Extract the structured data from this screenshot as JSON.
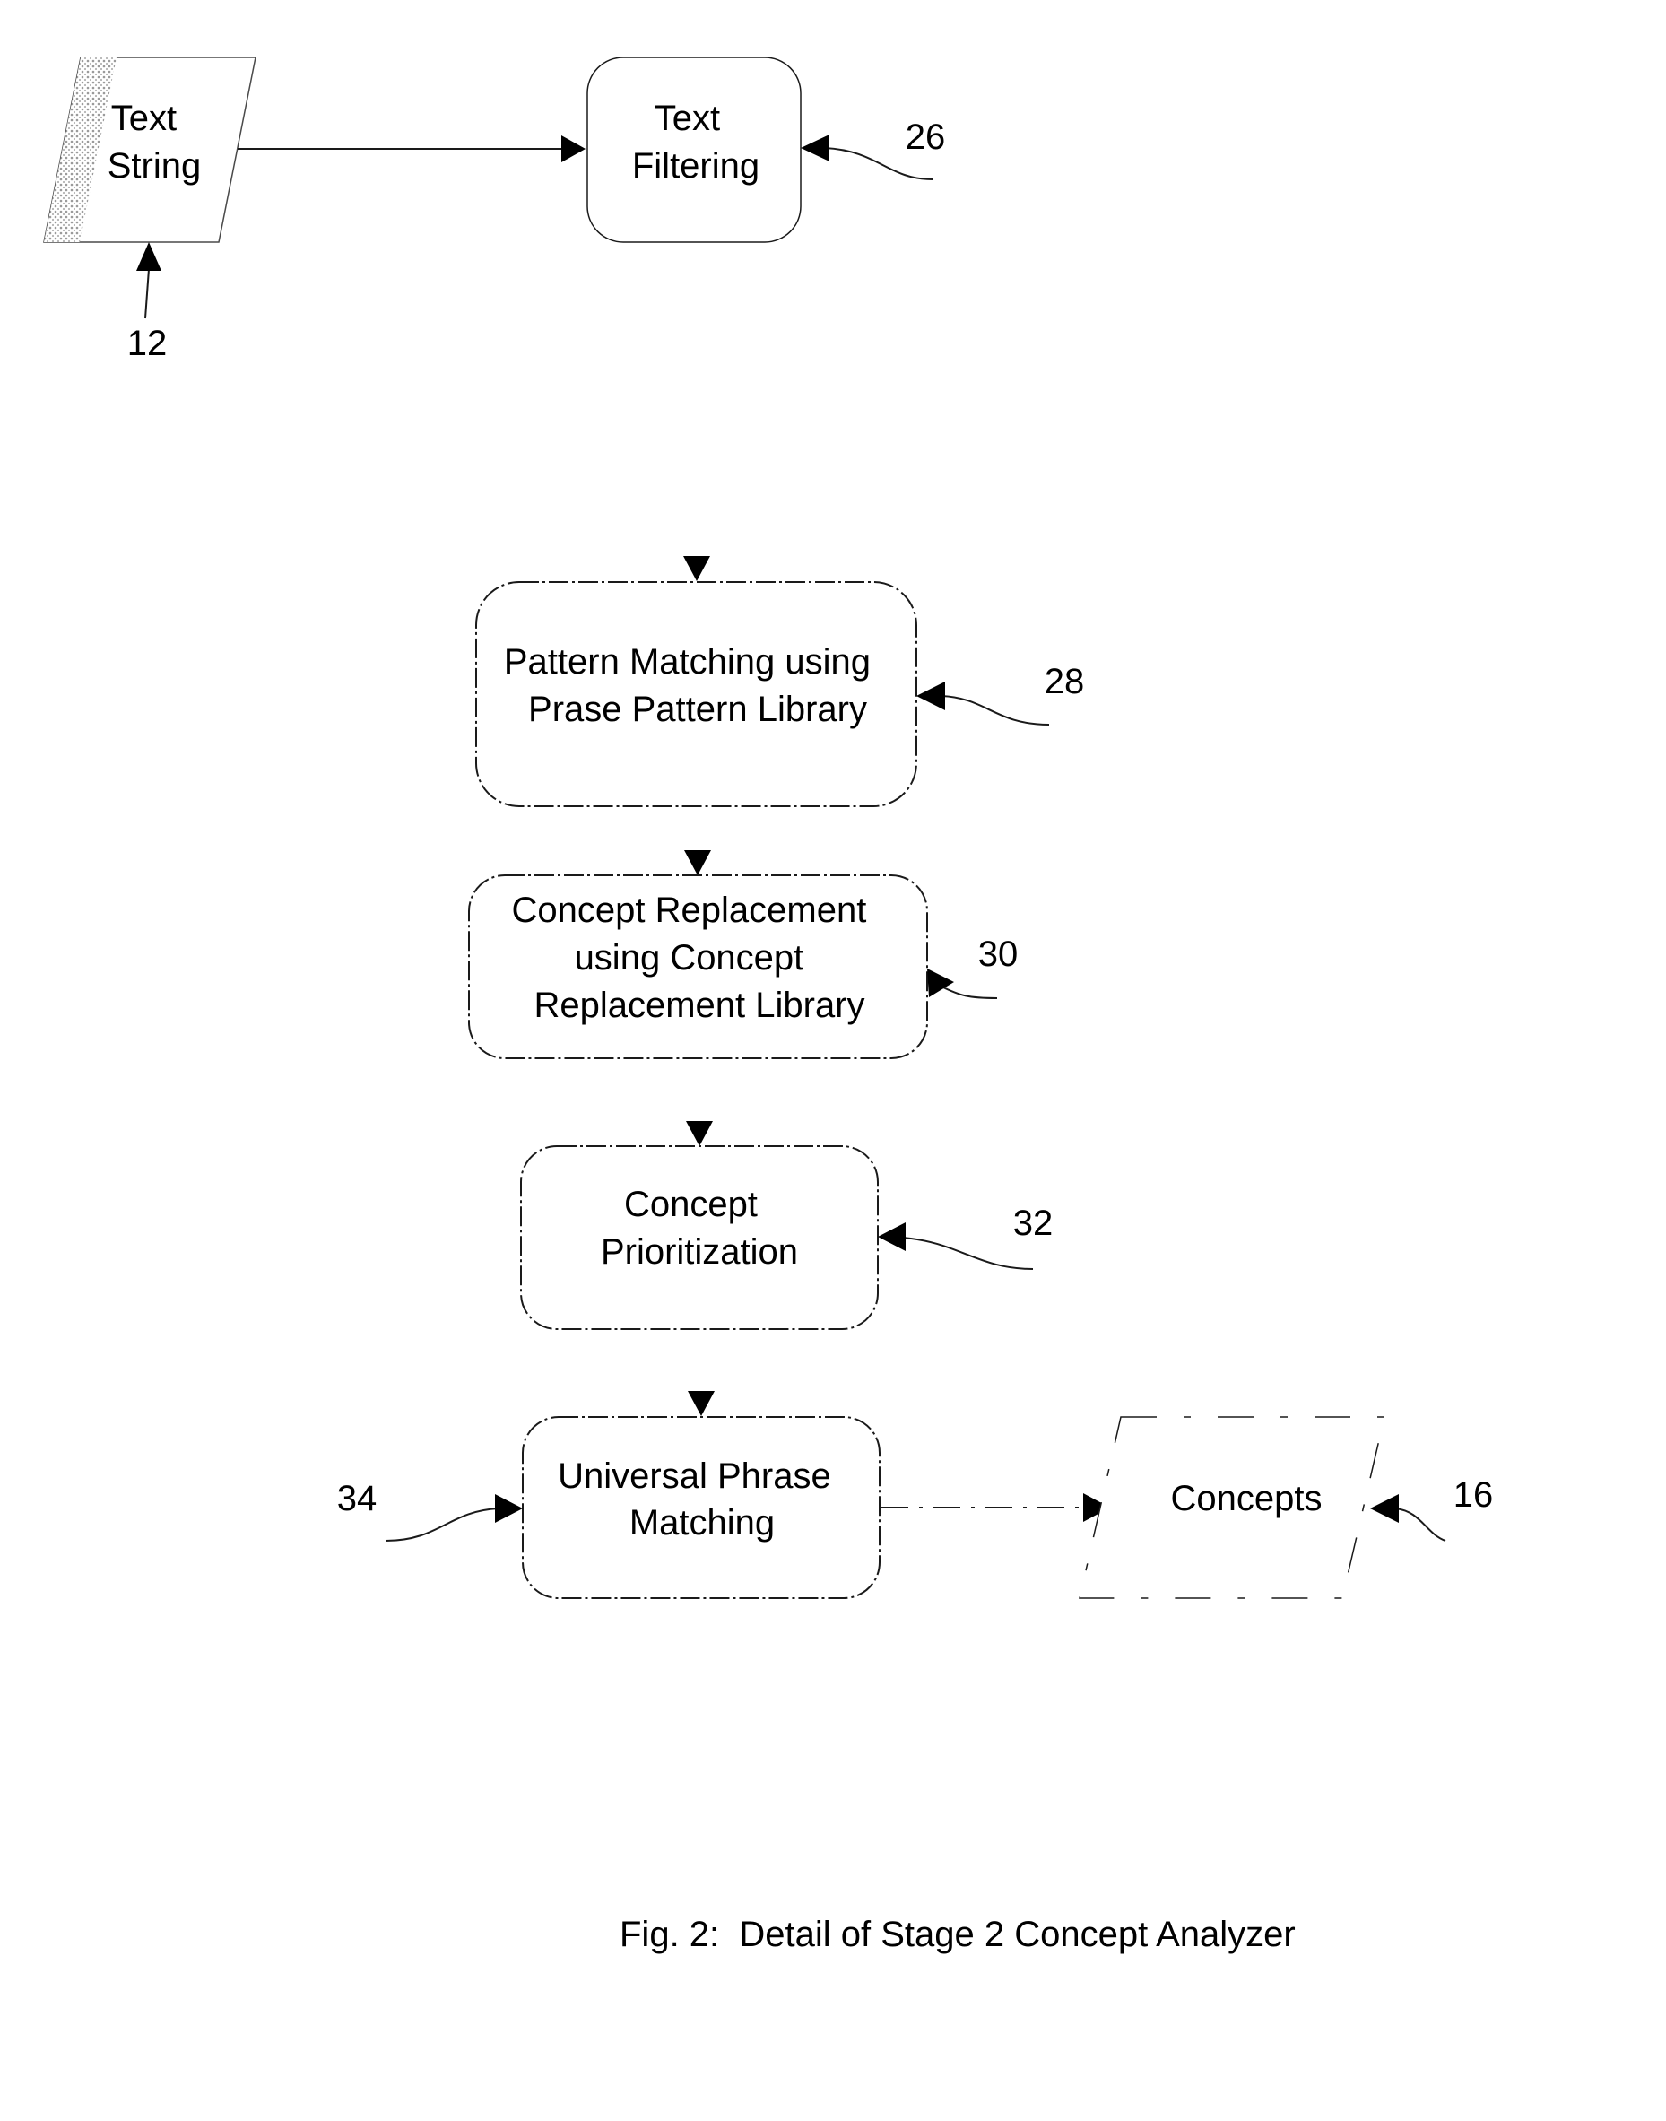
{
  "figure": {
    "caption": "Fig. 2:  Detail of Stage 2 Concept Analyzer"
  },
  "nodes": {
    "text_string": {
      "lines": [
        "Text",
        "String"
      ],
      "ref": "12",
      "shape": "parallelogram"
    },
    "text_filtering": {
      "lines": [
        "Text",
        "Filtering"
      ],
      "ref": "26",
      "shape": "rounded-rectangle"
    },
    "pattern_matching": {
      "lines": [
        "Pattern Matching using",
        "Prase Pattern Library"
      ],
      "ref": "28",
      "shape": "rounded-rectangle"
    },
    "concept_replacement": {
      "lines": [
        "Concept Replacement",
        "using Concept",
        "Replacement Library"
      ],
      "ref": "30",
      "shape": "rounded-rectangle"
    },
    "concept_prioritization": {
      "lines": [
        "Concept",
        "Prioritization"
      ],
      "ref": "32",
      "shape": "rounded-rectangle"
    },
    "universal_phrase_matching": {
      "lines": [
        "Universal Phrase",
        "Matching"
      ],
      "ref": "34",
      "shape": "rounded-rectangle"
    },
    "concepts": {
      "lines": [
        "Concepts"
      ],
      "ref": "16",
      "shape": "parallelogram"
    }
  },
  "edges": [
    {
      "from": "text_string",
      "to": "text_filtering"
    },
    {
      "from": "text_filtering",
      "to": "pattern_matching"
    },
    {
      "from": "pattern_matching",
      "to": "concept_replacement"
    },
    {
      "from": "concept_replacement",
      "to": "concept_prioritization"
    },
    {
      "from": "concept_prioritization",
      "to": "universal_phrase_matching"
    },
    {
      "from": "universal_phrase_matching",
      "to": "concepts"
    }
  ],
  "colors": {
    "line": "#1a1a1a",
    "text": "#000000",
    "background": "#ffffff",
    "shading": "#bdbdbd"
  }
}
